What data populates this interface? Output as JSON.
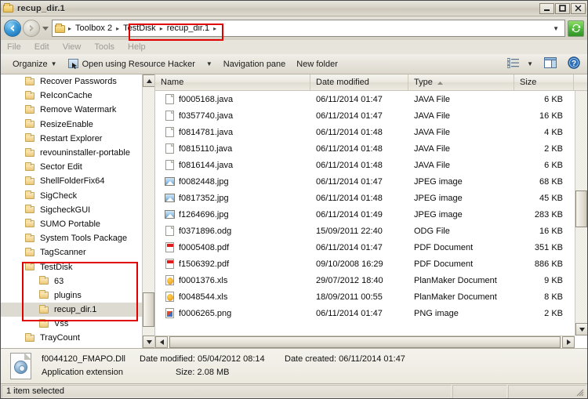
{
  "window": {
    "title": "recup_dir.1",
    "title_icon": "folder-icon",
    "minimize_label": "Minimize",
    "maximize_label": "Maximize",
    "close_label": "Close"
  },
  "address_bar": {
    "back_label": "Back",
    "forward_label": "Forward",
    "history_label": "Recent pages",
    "folder_icon": "folder-icon",
    "crumbs": [
      "Toolbox 2",
      "TestDisk",
      "recup_dir.1"
    ],
    "separator": "▸",
    "dropdown": "▼",
    "refresh_label": "Refresh",
    "refresh_icon": "refresh-icon"
  },
  "menu_bar": {
    "items": [
      "File",
      "Edit",
      "View",
      "Tools",
      "Help"
    ]
  },
  "command_bar": {
    "organize_label": "Organize",
    "organize_caret": "▼",
    "open_with_label": "Open using Resource Hacker",
    "open_with_icon": "resource-hacker-icon",
    "open_with_caret": "▼",
    "navigation_pane_label": "Navigation pane",
    "new_folder_label": "New folder",
    "view_icon": "list-view-icon",
    "view_caret": "▼",
    "preview_icon": "preview-pane-icon",
    "help_icon": "help-icon"
  },
  "navigation_pane": {
    "items": [
      {
        "label": "Recover Passwords",
        "level": 1,
        "selected": false
      },
      {
        "label": "ReIconCache",
        "level": 1,
        "selected": false
      },
      {
        "label": "Remove Watermark",
        "level": 1,
        "selected": false
      },
      {
        "label": "ResizeEnable",
        "level": 1,
        "selected": false
      },
      {
        "label": "Restart Explorer",
        "level": 1,
        "selected": false
      },
      {
        "label": "revouninstaller-portable",
        "level": 1,
        "selected": false
      },
      {
        "label": "Sector Edit",
        "level": 1,
        "selected": false
      },
      {
        "label": "ShellFolderFix64",
        "level": 1,
        "selected": false
      },
      {
        "label": "SigCheck",
        "level": 1,
        "selected": false
      },
      {
        "label": "SigcheckGUI",
        "level": 1,
        "selected": false
      },
      {
        "label": "SUMO Portable",
        "level": 1,
        "selected": false
      },
      {
        "label": "System Tools Package",
        "level": 1,
        "selected": false
      },
      {
        "label": "TagScanner",
        "level": 1,
        "selected": false
      },
      {
        "label": "TestDisk",
        "level": 1,
        "selected": false
      },
      {
        "label": "63",
        "level": 2,
        "selected": false
      },
      {
        "label": "plugins",
        "level": 2,
        "selected": false
      },
      {
        "label": "recup_dir.1",
        "level": 2,
        "selected": true
      },
      {
        "label": "Vss",
        "level": 2,
        "selected": false
      },
      {
        "label": "TrayCount",
        "level": 1,
        "selected": false
      }
    ]
  },
  "file_list": {
    "columns": [
      {
        "label": "Name",
        "sorted": false
      },
      {
        "label": "Date modified",
        "sorted": false
      },
      {
        "label": "Type",
        "sorted": true,
        "sort_arrow": "▲"
      },
      {
        "label": "Size",
        "sorted": false
      }
    ],
    "rows": [
      {
        "name": "f0005168.java",
        "date": "06/11/2014 01:47",
        "type": "JAVA File",
        "size": "6 KB",
        "icon": "generic-file-icon"
      },
      {
        "name": "f0357740.java",
        "date": "06/11/2014 01:47",
        "type": "JAVA File",
        "size": "16 KB",
        "icon": "generic-file-icon"
      },
      {
        "name": "f0814781.java",
        "date": "06/11/2014 01:48",
        "type": "JAVA File",
        "size": "4 KB",
        "icon": "generic-file-icon"
      },
      {
        "name": "f0815110.java",
        "date": "06/11/2014 01:48",
        "type": "JAVA File",
        "size": "2 KB",
        "icon": "generic-file-icon"
      },
      {
        "name": "f0816144.java",
        "date": "06/11/2014 01:48",
        "type": "JAVA File",
        "size": "6 KB",
        "icon": "generic-file-icon"
      },
      {
        "name": "f0082448.jpg",
        "date": "06/11/2014 01:47",
        "type": "JPEG image",
        "size": "68 KB",
        "icon": "image-file-icon"
      },
      {
        "name": "f0817352.jpg",
        "date": "06/11/2014 01:48",
        "type": "JPEG image",
        "size": "45 KB",
        "icon": "image-file-icon"
      },
      {
        "name": "f1264696.jpg",
        "date": "06/11/2014 01:49",
        "type": "JPEG image",
        "size": "283 KB",
        "icon": "image-file-icon"
      },
      {
        "name": "f0371896.odg",
        "date": "15/09/2011 22:40",
        "type": "ODG File",
        "size": "16 KB",
        "icon": "generic-file-icon"
      },
      {
        "name": "f0005408.pdf",
        "date": "06/11/2014 01:47",
        "type": "PDF Document",
        "size": "351 KB",
        "icon": "pdf-file-icon"
      },
      {
        "name": "f1506392.pdf",
        "date": "09/10/2008 16:29",
        "type": "PDF Document",
        "size": "886 KB",
        "icon": "pdf-file-icon"
      },
      {
        "name": "f0001376.xls",
        "date": "29/07/2012 18:40",
        "type": "PlanMaker Document",
        "size": "9 KB",
        "icon": "planmaker-file-icon"
      },
      {
        "name": "f0048544.xls",
        "date": "18/09/2011 00:55",
        "type": "PlanMaker Document",
        "size": "8 KB",
        "icon": "planmaker-file-icon"
      },
      {
        "name": "f0006265.png",
        "date": "06/11/2014 01:47",
        "type": "PNG image",
        "size": "2 KB",
        "icon": "png-file-icon"
      }
    ]
  },
  "details_pane": {
    "file_icon": "application-extension-icon",
    "file_name": "f0044120_FMAPO.Dll",
    "file_type": "Application extension",
    "date_modified_label": "Date modified:",
    "date_modified_value": "05/04/2012 08:14",
    "size_label": "Size:",
    "size_value": "2.08 MB",
    "date_created_label": "Date created:",
    "date_created_value": "06/11/2014 01:47"
  },
  "status_bar": {
    "text": "1 item selected",
    "resize_grip": "resize-grip-icon"
  },
  "annotations": {
    "highlight_color": "#e00000",
    "boxes": [
      "breadcrumb-path",
      "testdisk-tree-branch"
    ]
  }
}
